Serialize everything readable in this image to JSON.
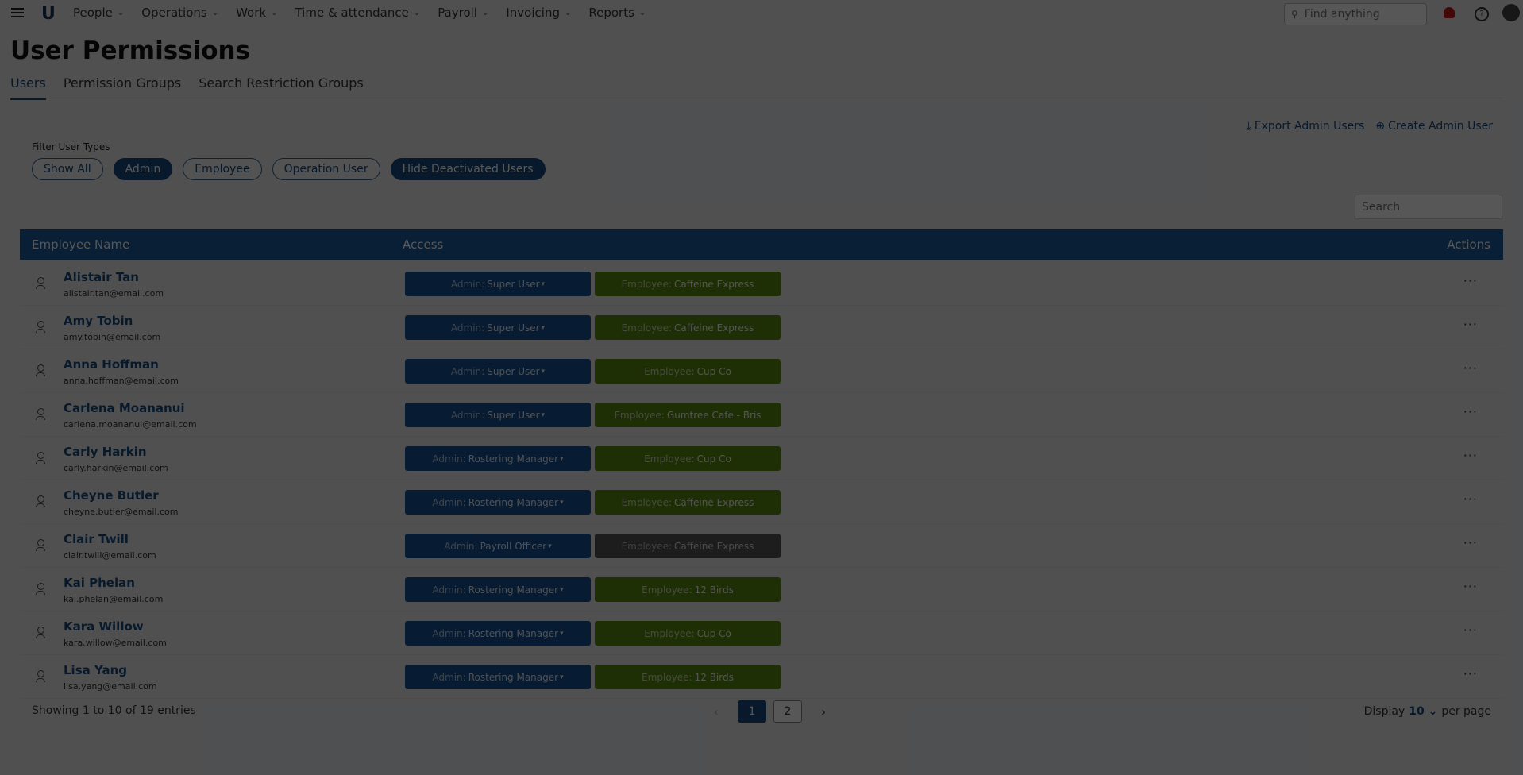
{
  "nav": {
    "items": [
      {
        "label": "People"
      },
      {
        "label": "Operations"
      },
      {
        "label": "Work"
      },
      {
        "label": "Time & attendance"
      },
      {
        "label": "Payroll"
      },
      {
        "label": "Invoicing"
      },
      {
        "label": "Reports"
      }
    ],
    "search_placeholder": "Find anything"
  },
  "page": {
    "title": "User Permissions",
    "tabs": [
      {
        "label": "Users",
        "active": true
      },
      {
        "label": "Permission Groups"
      },
      {
        "label": "Search Restriction Groups"
      }
    ]
  },
  "actions": {
    "export_label": "Export Admin Users",
    "create_label": "Create Admin User"
  },
  "filters": {
    "label": "Filter User Types",
    "chips": [
      {
        "label": "Show All"
      },
      {
        "label": "Admin",
        "on": true
      },
      {
        "label": "Employee"
      },
      {
        "label": "Operation User"
      },
      {
        "label": "Hide Deactivated Users",
        "on": true
      }
    ]
  },
  "search": {
    "placeholder": "Search"
  },
  "table": {
    "headers": {
      "name": "Employee Name",
      "access": "Access",
      "actions": "Actions"
    },
    "rows": [
      {
        "name": "Alistair Tan",
        "email": "alistair.tan@email.com",
        "admin_key": "Admin:",
        "admin_val": "Super User",
        "emp_key": "Employee:",
        "emp_val": "Caffeine Express"
      },
      {
        "name": "Amy Tobin",
        "email": "amy.tobin@email.com",
        "admin_key": "Admin:",
        "admin_val": "Super User",
        "emp_key": "Employee:",
        "emp_val": "Caffeine Express"
      },
      {
        "name": "Anna Hoffman",
        "email": "anna.hoffman@email.com",
        "admin_key": "Admin:",
        "admin_val": "Super User",
        "emp_key": "Employee:",
        "emp_val": "Cup Co"
      },
      {
        "name": "Carlena Moananui",
        "email": "carlena.moananui@email.com",
        "admin_key": "Admin:",
        "admin_val": "Super User",
        "emp_key": "Employee:",
        "emp_val": "Gumtree Cafe - Bris"
      },
      {
        "name": "Carly Harkin",
        "email": "carly.harkin@email.com",
        "admin_key": "Admin:",
        "admin_val": "Rostering Manager",
        "emp_key": "Employee:",
        "emp_val": "Cup Co"
      },
      {
        "name": "Cheyne Butler",
        "email": "cheyne.butler@email.com",
        "admin_key": "Admin:",
        "admin_val": "Rostering Manager",
        "emp_key": "Employee:",
        "emp_val": "Caffeine Express"
      },
      {
        "name": "Clair Twill",
        "email": "clair.twill@email.com",
        "admin_key": "Admin:",
        "admin_val": "Payroll Officer",
        "emp_key": "Employee:",
        "emp_val": "Caffeine Express",
        "emp_grey": true
      },
      {
        "name": "Kai Phelan",
        "email": "kai.phelan@email.com",
        "admin_key": "Admin:",
        "admin_val": "Rostering Manager",
        "emp_key": "Employee:",
        "emp_val": "12 Birds"
      },
      {
        "name": "Kara Willow",
        "email": "kara.willow@email.com",
        "admin_key": "Admin:",
        "admin_val": "Rostering Manager",
        "emp_key": "Employee:",
        "emp_val": "Cup Co"
      },
      {
        "name": "Lisa Yang",
        "email": "lisa.yang@email.com",
        "admin_key": "Admin:",
        "admin_val": "Rostering Manager",
        "emp_key": "Employee:",
        "emp_val": "12 Birds"
      }
    ]
  },
  "footer": {
    "showing": "Showing 1 to 10 of 19 entries",
    "pages": [
      "1",
      "2"
    ],
    "display_label": "Display",
    "per_page_value": "10",
    "per_page_label": "per page"
  },
  "icons": [
    "menu-icon",
    "logo-icon",
    "chevron-down-icon",
    "search-icon",
    "bell-icon",
    "help-icon",
    "avatar",
    "download-icon",
    "plus-circle-icon",
    "user-icon",
    "more-icon",
    "chevron-left-icon",
    "chevron-right-icon"
  ]
}
